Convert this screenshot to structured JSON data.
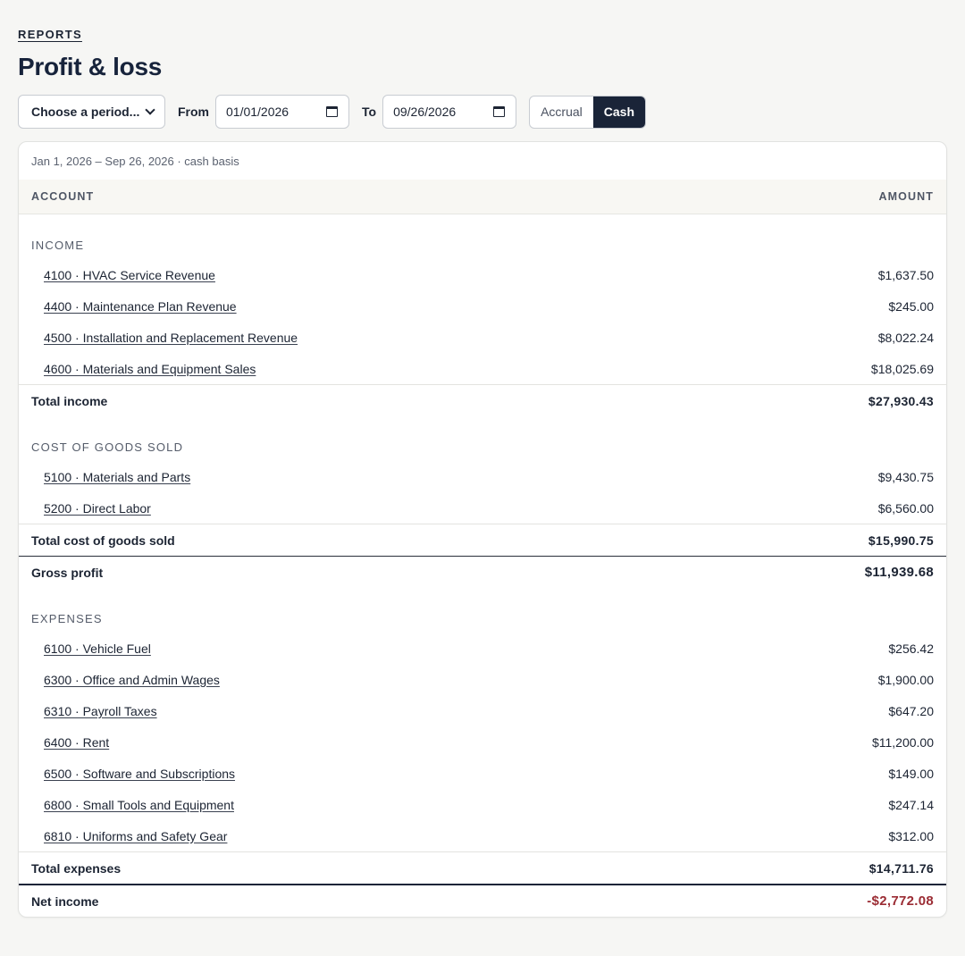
{
  "header": {
    "eyebrow": "REPORTS",
    "title": "Profit & loss"
  },
  "controls": {
    "period_select": "Choose a period...",
    "from_label": "From",
    "from_value": "01/01/2026",
    "to_label": "To",
    "to_value": "09/26/2026",
    "basis_options": [
      "Accrual",
      "Cash"
    ],
    "basis_selected": "Cash"
  },
  "report": {
    "caption": "Jan 1, 2026 – Sep 26, 2026 · cash basis",
    "columns": {
      "account": "ACCOUNT",
      "amount": "AMOUNT"
    },
    "income": {
      "heading": "INCOME",
      "rows": [
        {
          "account": "4100 · HVAC Service Revenue",
          "amount": "$1,637.50"
        },
        {
          "account": "4400 · Maintenance Plan Revenue",
          "amount": "$245.00"
        },
        {
          "account": "4500 · Installation and Replacement Revenue",
          "amount": "$8,022.24"
        },
        {
          "account": "4600 · Materials and Equipment Sales",
          "amount": "$18,025.69"
        }
      ],
      "total_label": "Total income",
      "total_amount": "$27,930.43"
    },
    "cogs": {
      "heading": "COST OF GOODS SOLD",
      "rows": [
        {
          "account": "5100 · Materials and Parts",
          "amount": "$9,430.75"
        },
        {
          "account": "5200 · Direct Labor",
          "amount": "$6,560.00"
        }
      ],
      "total_label": "Total cost of goods sold",
      "total_amount": "$15,990.75"
    },
    "gross_profit": {
      "label": "Gross profit",
      "amount": "$11,939.68"
    },
    "expenses": {
      "heading": "EXPENSES",
      "rows": [
        {
          "account": "6100 · Vehicle Fuel",
          "amount": "$256.42"
        },
        {
          "account": "6300 · Office and Admin Wages",
          "amount": "$1,900.00"
        },
        {
          "account": "6310 · Payroll Taxes",
          "amount": "$647.20"
        },
        {
          "account": "6400 · Rent",
          "amount": "$11,200.00"
        },
        {
          "account": "6500 · Software and Subscriptions",
          "amount": "$149.00"
        },
        {
          "account": "6800 · Small Tools and Equipment",
          "amount": "$247.14"
        },
        {
          "account": "6810 · Uniforms and Safety Gear",
          "amount": "$312.00"
        }
      ],
      "total_label": "Total expenses",
      "total_amount": "$14,711.76"
    },
    "net_income": {
      "label": "Net income",
      "amount": "-$2,772.08",
      "color": "#9b2c34"
    }
  }
}
